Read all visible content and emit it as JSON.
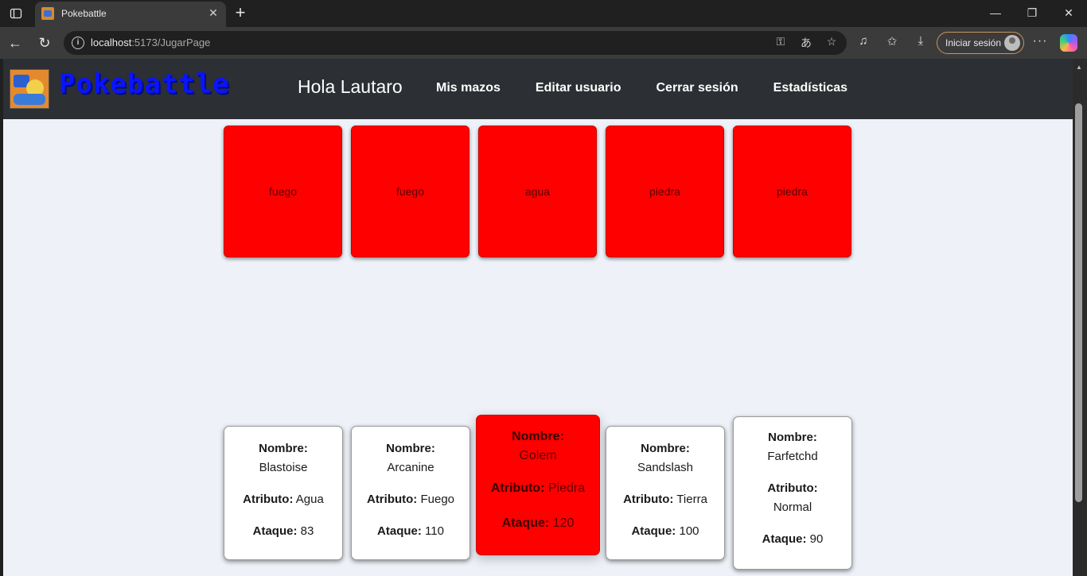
{
  "browser": {
    "tab_title": "Pokebattle",
    "url_host": "localhost",
    "url_rest": ":5173/JugarPage",
    "signin_label": "Iniciar sesión"
  },
  "header": {
    "brand": "Pokebattle",
    "greeting": "Hola Lautaro",
    "nav": [
      "Mis mazos",
      "Editar usuario",
      "Cerrar sesión",
      "Estadísticas"
    ]
  },
  "enemy_cards": [
    "fuego",
    "fuego",
    "agua",
    "piedra",
    "piedra"
  ],
  "labels": {
    "nombre": "Nombre:",
    "atributo": "Atributo:",
    "ataque": "Ataque:"
  },
  "player_cards": [
    {
      "nombre": "Blastoise",
      "atributo": "Agua",
      "ataque": "83",
      "selected": false
    },
    {
      "nombre": "Arcanine",
      "atributo": "Fuego",
      "ataque": "110",
      "selected": false
    },
    {
      "nombre": "Golem",
      "atributo": "Piedra",
      "ataque": "120",
      "selected": true
    },
    {
      "nombre": "Sandslash",
      "atributo": "Tierra",
      "ataque": "100",
      "selected": false
    },
    {
      "nombre": "Farfetchd",
      "atributo": "Normal",
      "ataque": "90",
      "selected": false
    }
  ],
  "colors": {
    "card_red": "#ff0000",
    "header_bg": "#2c2f33",
    "brand_blue": "#0a14ff",
    "page_bg": "#eef2f8"
  }
}
